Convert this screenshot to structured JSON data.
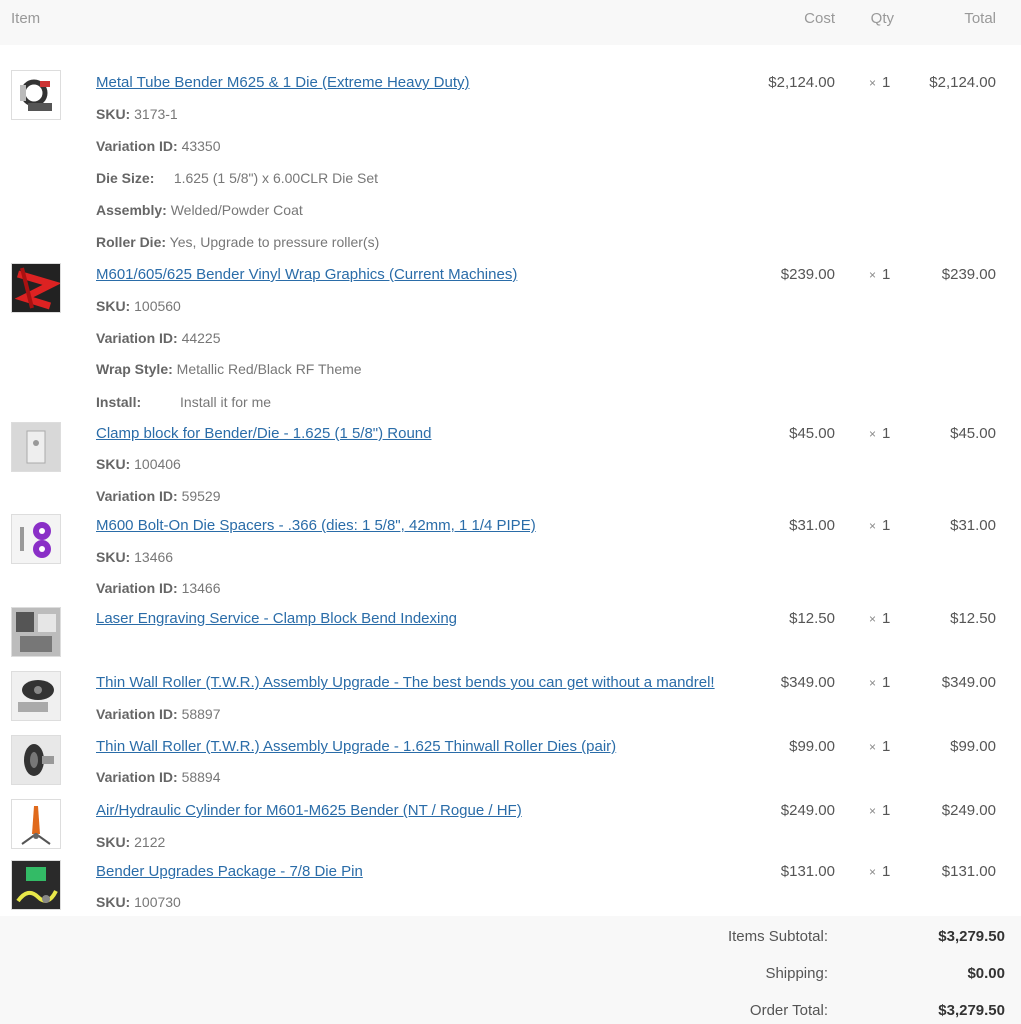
{
  "header": {
    "item": "Item",
    "cost": "Cost",
    "qty": "Qty",
    "total": "Total"
  },
  "items": [
    {
      "name": "Metal Tube Bender M625 & 1 Die (Extreme Heavy Duty)",
      "cost": "$2,124.00",
      "qty_symbol": "×",
      "qty": "1",
      "total": "$2,124.00",
      "meta": [
        {
          "label": "SKU:",
          "value": "3173-1"
        },
        {
          "label": "Variation ID:",
          "value": "43350"
        },
        {
          "label": "Die Size:",
          "value": "1.625 (1 5/8\") x 6.00CLR Die Set"
        },
        {
          "label": "Assembly:",
          "value": "Welded/Powder Coat"
        },
        {
          "label": "Roller Die:",
          "value": "Yes, Upgrade to pressure roller(s)"
        }
      ]
    },
    {
      "name": "M601/605/625 Bender Vinyl Wrap Graphics (Current Machines)",
      "cost": "$239.00",
      "qty_symbol": "×",
      "qty": "1",
      "total": "$239.00",
      "meta": [
        {
          "label": "SKU:",
          "value": "100560"
        },
        {
          "label": "Variation ID:",
          "value": "44225"
        },
        {
          "label": "Wrap Style:",
          "value": "Metallic Red/Black RF Theme"
        },
        {
          "label": "Install:",
          "value": "Install it for me"
        }
      ]
    },
    {
      "name": "Clamp block for Bender/Die - 1.625 (1 5/8\") Round",
      "cost": "$45.00",
      "qty_symbol": "×",
      "qty": "1",
      "total": "$45.00",
      "meta": [
        {
          "label": "SKU:",
          "value": "100406"
        },
        {
          "label": "Variation ID:",
          "value": "59529"
        }
      ]
    },
    {
      "name": "M600 Bolt-On Die Spacers - .366 (dies: 1 5/8\", 42mm, 1 1/4 PIPE)",
      "cost": "$31.00",
      "qty_symbol": "×",
      "qty": "1",
      "total": "$31.00",
      "meta": [
        {
          "label": "SKU:",
          "value": "13466"
        },
        {
          "label": "Variation ID:",
          "value": "13466"
        }
      ]
    },
    {
      "name": "Laser Engraving Service - Clamp Block Bend Indexing",
      "cost": "$12.50",
      "qty_symbol": "×",
      "qty": "1",
      "total": "$12.50",
      "meta": []
    },
    {
      "name": "Thin Wall Roller (T.W.R.) Assembly Upgrade - The best bends you can get without a mandrel!",
      "cost": "$349.00",
      "qty_symbol": "×",
      "qty": "1",
      "total": "$349.00",
      "meta": [
        {
          "label": "Variation ID:",
          "value": "58897"
        }
      ]
    },
    {
      "name": "Thin Wall Roller (T.W.R.) Assembly Upgrade  - 1.625 Thinwall Roller Dies (pair)",
      "cost": "$99.00",
      "qty_symbol": "×",
      "qty": "1",
      "total": "$99.00",
      "meta": [
        {
          "label": "Variation ID:",
          "value": "58894"
        }
      ]
    },
    {
      "name": "Air/Hydraulic Cylinder for M601-M625 Bender (NT / Rogue / HF)",
      "cost": "$249.00",
      "qty_symbol": "×",
      "qty": "1",
      "total": "$249.00",
      "meta": [
        {
          "label": "SKU:",
          "value": "2122"
        }
      ]
    },
    {
      "name": "Bender Upgrades Package - 7/8 Die Pin",
      "cost": "$131.00",
      "qty_symbol": "×",
      "qty": "1",
      "total": "$131.00",
      "meta": [
        {
          "label": "SKU:",
          "value": "100730"
        }
      ]
    }
  ],
  "totals": {
    "subtotal_label": "Items Subtotal:",
    "subtotal": "$3,279.50",
    "shipping_label": "Shipping:",
    "shipping": "$0.00",
    "order_total_label": "Order Total:",
    "order_total": "$3,279.50"
  },
  "colors": {
    "link": "#2a6ca8",
    "text": "#777777",
    "header_bg": "#f8f8f8"
  }
}
